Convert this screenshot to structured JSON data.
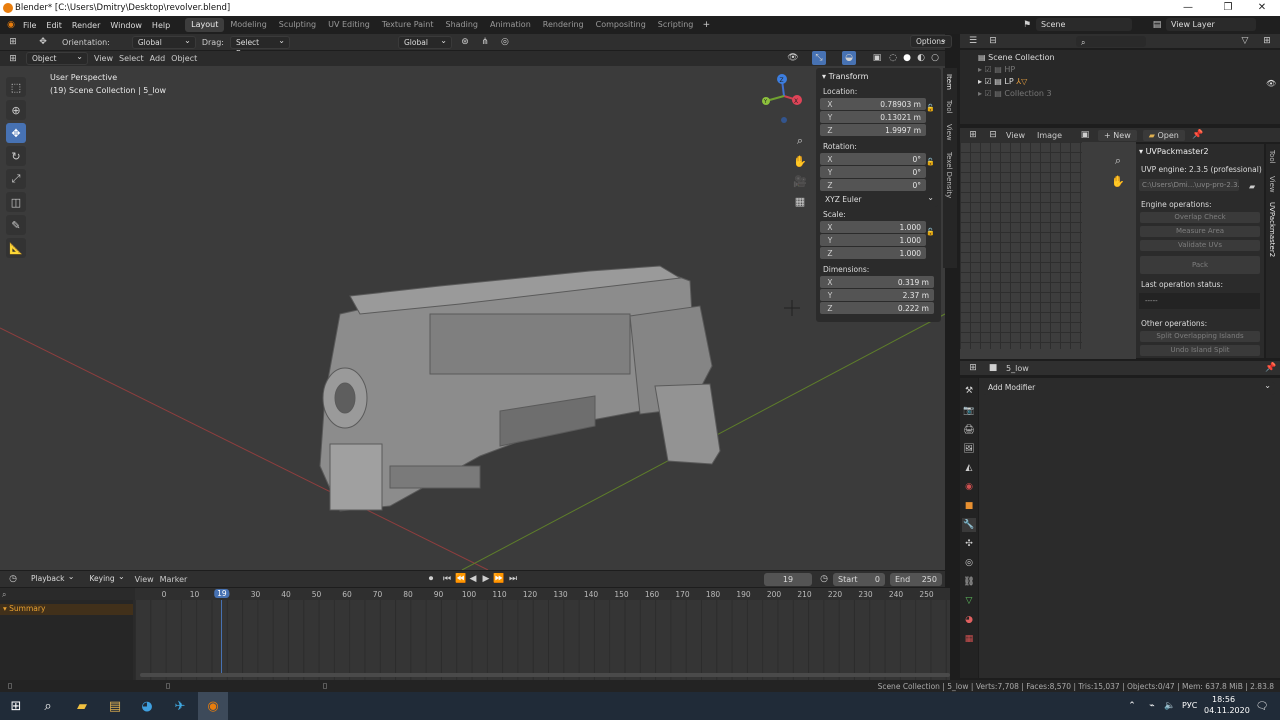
{
  "title": "Blender* [C:\\Users\\Dmitry\\Desktop\\revolver.blend]",
  "menu": [
    "File",
    "Edit",
    "Render",
    "Window",
    "Help"
  ],
  "workspaces": [
    "Layout",
    "Modeling",
    "Sculpting",
    "UV Editing",
    "Texture Paint",
    "Shading",
    "Animation",
    "Rendering",
    "Compositing",
    "Scripting"
  ],
  "scene": "Scene",
  "view_layer": "View Layer",
  "tool_header": {
    "orientation_label": "Orientation:",
    "orientation": "Global",
    "drag_label": "Drag:",
    "drag": "Select Box",
    "pivot": "Global",
    "options": "Options"
  },
  "viewport_header": {
    "mode": "Object Mode",
    "items": [
      "View",
      "Select",
      "Add",
      "Object"
    ]
  },
  "viewport_text": {
    "perspective": "User Perspective",
    "collection": "(19) Scene Collection | 5_low"
  },
  "gizmo": {
    "x": "X",
    "y": "Y",
    "z": "Z"
  },
  "npanel": {
    "title": "Transform",
    "location_label": "Location:",
    "location": [
      {
        "ax": "X",
        "v": "0.78903 m"
      },
      {
        "ax": "Y",
        "v": "0.13021 m"
      },
      {
        "ax": "Z",
        "v": "1.9997 m"
      }
    ],
    "rotation_label": "Rotation:",
    "rotation": [
      {
        "ax": "X",
        "v": "0°"
      },
      {
        "ax": "Y",
        "v": "0°"
      },
      {
        "ax": "Z",
        "v": "0°"
      }
    ],
    "rotation_mode": "XYZ Euler",
    "scale_label": "Scale:",
    "scale": [
      {
        "ax": "X",
        "v": "1.000"
      },
      {
        "ax": "Y",
        "v": "1.000"
      },
      {
        "ax": "Z",
        "v": "1.000"
      }
    ],
    "dimensions_label": "Dimensions:",
    "dimensions": [
      {
        "ax": "X",
        "v": "0.319 m"
      },
      {
        "ax": "Y",
        "v": "2.37 m"
      },
      {
        "ax": "Z",
        "v": "0.222 m"
      }
    ],
    "tabs": [
      "Item",
      "Tool",
      "View",
      "Texel Density"
    ]
  },
  "outliner": {
    "root": "Scene Collection",
    "items": [
      "HP",
      "LP",
      "Collection 3"
    ]
  },
  "uv_header": {
    "items": [
      "View",
      "Image"
    ],
    "new": "New",
    "open": "Open"
  },
  "uvpack": {
    "title": "UVPackmaster2",
    "engine": "UVP engine: 2.3.5 (professional)",
    "path": "C:\\Users\\Dmi...\\uvp-pro-2.3.5",
    "engine_ops": "Engine operations:",
    "buttons": [
      "Overlap Check",
      "Measure Area",
      "Validate UVs"
    ],
    "pack": "Pack",
    "last_status": "Last operation status:",
    "status_value": "-----",
    "other_ops": "Other operations:",
    "other_buttons": [
      "Split Overlapping Islands",
      "Undo Island Split"
    ],
    "tabs": [
      "Tool",
      "View",
      "UVPackmaster2"
    ]
  },
  "properties": {
    "object": "5_low",
    "add_modifier": "Add Modifier"
  },
  "timeline": {
    "items": [
      "Playback",
      "Keying",
      "View",
      "Marker"
    ],
    "current": "19",
    "start_label": "Start",
    "start": "0",
    "end_label": "End",
    "end": "250",
    "ticks": [
      "0",
      "10",
      "20",
      "30",
      "40",
      "50",
      "60",
      "70",
      "80",
      "90",
      "100",
      "110",
      "120",
      "130",
      "140",
      "150",
      "160",
      "170",
      "180",
      "190",
      "200",
      "210",
      "220",
      "230",
      "240",
      "250"
    ],
    "summary": "Summary"
  },
  "statusbar": "Scene Collection | 5_low | Verts:7,708 | Faces:8,570 | Tris:15,037 | Objects:0/47 | Mem: 637.8 MiB | 2.83.8",
  "taskbar": {
    "lang": "РУС",
    "time": "18:56",
    "date": "04.11.2020"
  },
  "colors": {
    "accent": "#4772b3",
    "viewport": "#3b3b3b",
    "panel": "#2b2b2b"
  }
}
